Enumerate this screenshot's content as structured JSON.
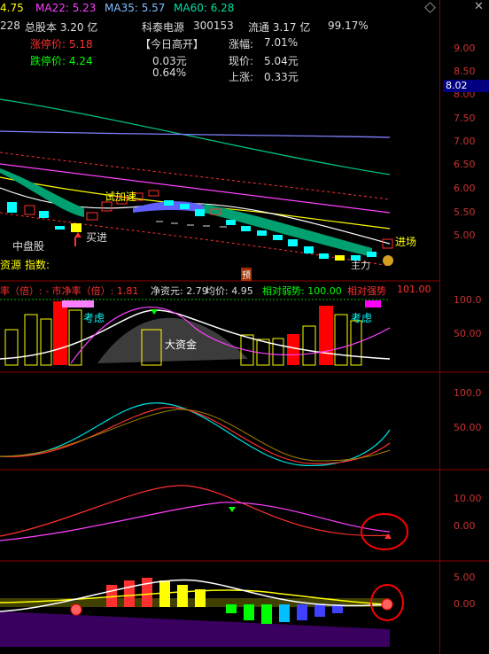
{
  "header": {
    "ma_first": "4.75",
    "ma22": "MA22: 5.23",
    "ma35": "MA35: 5.57",
    "ma60": "MA60: 6.28",
    "prefix": "228",
    "total_share": "总股本 3.20 亿",
    "stock_name": "科泰电源",
    "stock_code": "300153",
    "circulation": "流通 3.17 亿",
    "percent": "99.17%",
    "limit_up": "涨停价: 5.18",
    "limit_down": "跌停价: 4.24",
    "open_tag": "【今日高开】",
    "open_val1": "0.03元",
    "open_val2": "0.64%",
    "change_label": "涨幅:",
    "change_val": "7.01%",
    "price_label": "现价:",
    "price_val": "5.04元",
    "rise_label": "上涨:",
    "rise_val": "0.33元",
    "badge_price": "8.02"
  },
  "main_chart": {
    "yticks": [
      "9.00",
      "8.50",
      "8.00",
      "7.50",
      "7.00",
      "6.50",
      "6.00",
      "5.50",
      "5.00"
    ],
    "labels": {
      "try_speed": "试加速",
      "buy": "买进",
      "enter": "进场",
      "mid_small": "中盘股",
      "resource": "资源",
      "index": "指数:",
      "pre": "预",
      "main_force": "主力"
    },
    "colors": {
      "up": "#ff3333",
      "down": "#00ffff",
      "ma22": "#ff40ff",
      "ma35": "#8080ff",
      "ma60": "#00c080"
    }
  },
  "panel2": {
    "header_left": "率（倍）: - 市净率（倍）: 1.81",
    "net_asset": "净资元: 2.79",
    "avg_price": "均价: 4.95",
    "rel_strength": "相对弱势: 100.00",
    "hidden_label": "相对强势",
    "hidden_val": "101.00",
    "consider1": "考虑",
    "consider2": "考虑",
    "big_fund": "大资金",
    "yticks": [
      "100.0",
      "50.00"
    ]
  },
  "panel3": {
    "yticks": [
      "100.0",
      "50.00"
    ]
  },
  "panel4": {
    "yticks": [
      "10.00",
      "0.00"
    ]
  },
  "panel5": {
    "yticks": [
      "5.00",
      "0.00"
    ]
  }
}
